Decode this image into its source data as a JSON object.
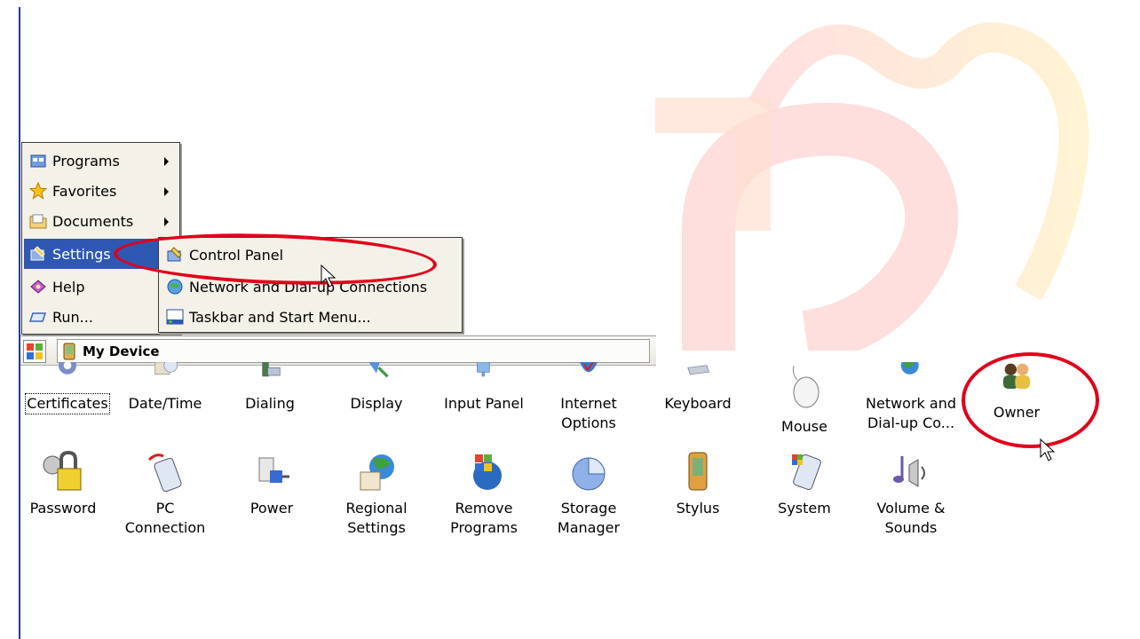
{
  "start_menu": {
    "items": [
      {
        "label": "Programs",
        "icon": "programs-icon",
        "has_submenu": true
      },
      {
        "label": "Favorites",
        "icon": "favorites-star-icon",
        "has_submenu": true
      },
      {
        "label": "Documents",
        "icon": "documents-folder-icon",
        "has_submenu": true
      },
      {
        "label": "Settings",
        "icon": "settings-icon",
        "has_submenu": true,
        "selected": true
      },
      {
        "label": "Help",
        "icon": "help-book-icon",
        "has_submenu": false
      },
      {
        "label": "Run...",
        "icon": "run-icon",
        "has_submenu": false
      }
    ]
  },
  "settings_submenu": {
    "items": [
      {
        "label": "Control Panel",
        "icon": "control-panel-icon"
      },
      {
        "label": "Network and Dial-up Connections",
        "icon": "network-icon"
      },
      {
        "label": "Taskbar and Start Menu...",
        "icon": "taskbar-icon"
      }
    ]
  },
  "taskbar": {
    "start_icon": "windows-flag-icon",
    "task_label": "My Device"
  },
  "control_panel": {
    "row1": [
      {
        "label": "Certificates",
        "icon": "certificates-icon"
      },
      {
        "label": "Date/Time",
        "icon": "date-time-icon"
      },
      {
        "label": "Dialing",
        "icon": "dialing-icon"
      },
      {
        "label": "Display",
        "icon": "display-icon"
      },
      {
        "label": "Input Panel",
        "icon": "input-panel-icon"
      },
      {
        "label": "Internet Options",
        "icon": "internet-options-icon"
      },
      {
        "label": "Keyboard",
        "icon": "keyboard-icon"
      },
      {
        "label": "Mouse",
        "icon": "mouse-icon"
      },
      {
        "label": "Network and Dial-up Co...",
        "icon": "network-dialup-icon"
      },
      {
        "label": "Owner",
        "icon": "owner-icon"
      }
    ],
    "row2": [
      {
        "label": "Password",
        "icon": "password-lock-icon"
      },
      {
        "label": "PC Connection",
        "icon": "pc-connection-icon"
      },
      {
        "label": "Power",
        "icon": "power-plug-icon"
      },
      {
        "label": "Regional Settings",
        "icon": "regional-settings-icon"
      },
      {
        "label": "Remove Programs",
        "icon": "remove-programs-icon"
      },
      {
        "label": "Storage Manager",
        "icon": "storage-manager-icon"
      },
      {
        "label": "Stylus",
        "icon": "stylus-icon"
      },
      {
        "label": "System",
        "icon": "system-icon"
      },
      {
        "label": "Volume & Sounds",
        "icon": "volume-sounds-icon"
      }
    ]
  },
  "colors": {
    "selection_blue": "#2f58b3",
    "annotation_red": "#e0001a",
    "menu_bg": "#f3f1e8"
  }
}
